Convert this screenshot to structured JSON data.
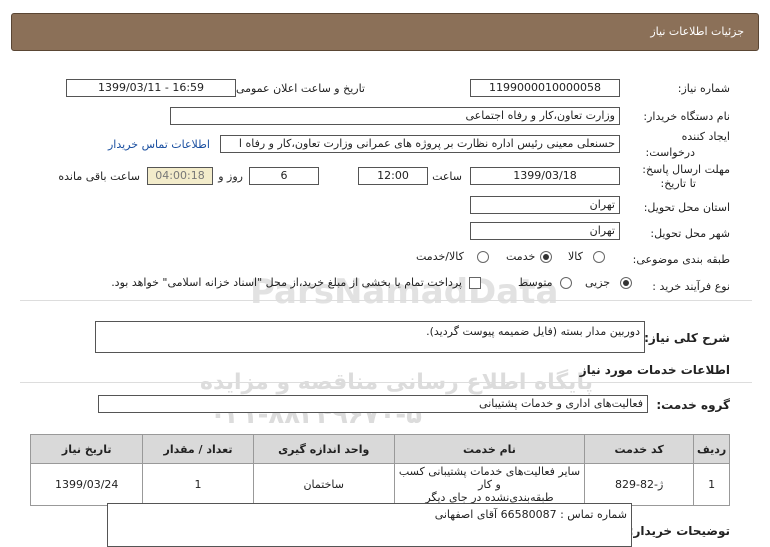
{
  "title": "جزئیات اطلاعات نیاز",
  "watermarks": {
    "w1": "ParsNamadData",
    "w2": "پایگاه اطلاع رسانی مناقصه و مزایده",
    "w3": "۰۲۱-۸۸۳۴۹۶۷۰-۵"
  },
  "fields": {
    "need_number_label": "شماره نیاز:",
    "need_number": "1199000010000058",
    "announce_label": "تاریخ و ساعت اعلان عمومی:",
    "announce_value": "1399/03/11 - 16:59",
    "buyer_org_label": "نام دستگاه خریدار:",
    "buyer_org": "وزارت تعاون،کار و رفاه اجتماعی",
    "creator_label_1": "ایجاد کننده",
    "creator_label_2": "درخواست:",
    "creator_value": "حسنعلی معینی رئیس اداره نظارت بر پروژه های عمرانی وزارت تعاون،کار و رفاه ا",
    "buyer_contact_link": "اطلاعات تماس خریدار",
    "deadline_label_1": "مهلت ارسال پاسخ:",
    "deadline_label_2": "تا تاریخ:",
    "deadline_date": "1399/03/18",
    "time_label": "ساعت",
    "deadline_time": "12:00",
    "days_value": "6",
    "days_label": "روز و",
    "remaining_value": "04:00:18",
    "remaining_label": "ساعت باقی مانده",
    "province_label": "استان محل تحویل:",
    "province": "تهران",
    "city_label": "شهر محل تحویل:",
    "city": "تهران",
    "category_label": "طبقه بندی موضوعی:",
    "category_options": [
      "کالا",
      "خدمت",
      "کالا/خدمت"
    ],
    "purchase_label": "نوع فرآیند خرید :",
    "purchase_options": [
      "جزیی",
      "متوسط"
    ],
    "payment_note": "پرداخت تمام یا بخشی از مبلغ خرید،از محل \"اسناد خزانه اسلامی\" خواهد بود.",
    "summary_label": "شرح کلی نیاز:",
    "summary_value": "دوربین مدار بسته (فایل ضمیمه پیوست گردید).",
    "services_info_label": "اطلاعات خدمات مورد نیاز",
    "service_group_label": "گروه خدمت:",
    "service_group_value": "فعالیت‌های اداری و خدمات پشتیبانی",
    "buyer_notes_label": "توضیحات خریدار:",
    "buyer_notes_value": "شماره تماس : 66580087 آقای اصفهانی"
  },
  "table": {
    "headers": [
      "ردیف",
      "کد خدمت",
      "نام خدمت",
      "واحد اندازه گیری",
      "تعداد / مقدار",
      "تاریخ نیاز"
    ],
    "rows": [
      {
        "c0": "1",
        "c1": "ژ-82-829",
        "c2a": "سایر فعالیت‌های خدمات پشتیبانی کسب و کار",
        "c2b": "طبقه‌بندی‌نشده در جای دیگر",
        "c3": "ساختمان",
        "c4": "1",
        "c5": "1399/03/24"
      }
    ]
  }
}
